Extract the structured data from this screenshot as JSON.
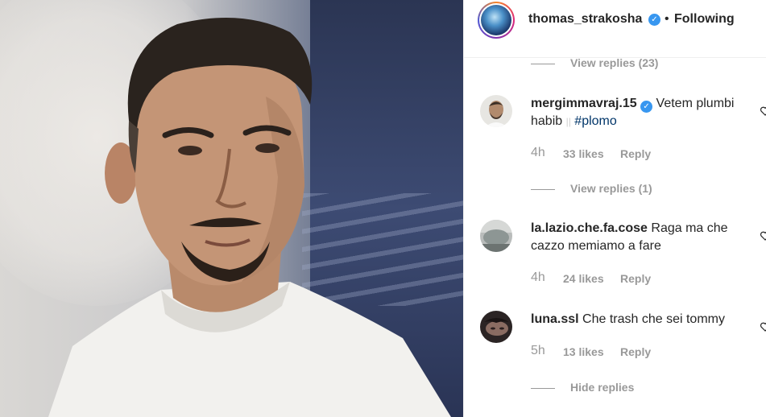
{
  "header": {
    "username": "thomas_strakosha",
    "separator": "•",
    "follow_status": "Following"
  },
  "top_view_replies": "View replies (23)",
  "comments": [
    {
      "username": "mergimmavraj.15",
      "verified": true,
      "text_before": "Vetem plumbi habib",
      "separator": "||",
      "hashtag": "#plomo",
      "time": "4h",
      "likes": "33 likes",
      "reply": "Reply",
      "replies_label": "View replies (1)"
    },
    {
      "username": "la.lazio.che.fa.cose",
      "text": "Raga ma che cazzo memiamo a fare",
      "time": "4h",
      "likes": "24 likes",
      "reply": "Reply"
    },
    {
      "username": "luna.ssl",
      "text": "Che trash che sei tommy",
      "time": "5h",
      "likes": "13 likes",
      "reply": "Reply",
      "replies_label": "Hide replies"
    }
  ],
  "icons": {
    "verified": "verified-badge-icon",
    "like": "heart-icon"
  },
  "colors": {
    "verified_blue": "#3897f0",
    "secondary_text": "#999999",
    "hashtag": "#003569",
    "primary_text": "#262626"
  }
}
